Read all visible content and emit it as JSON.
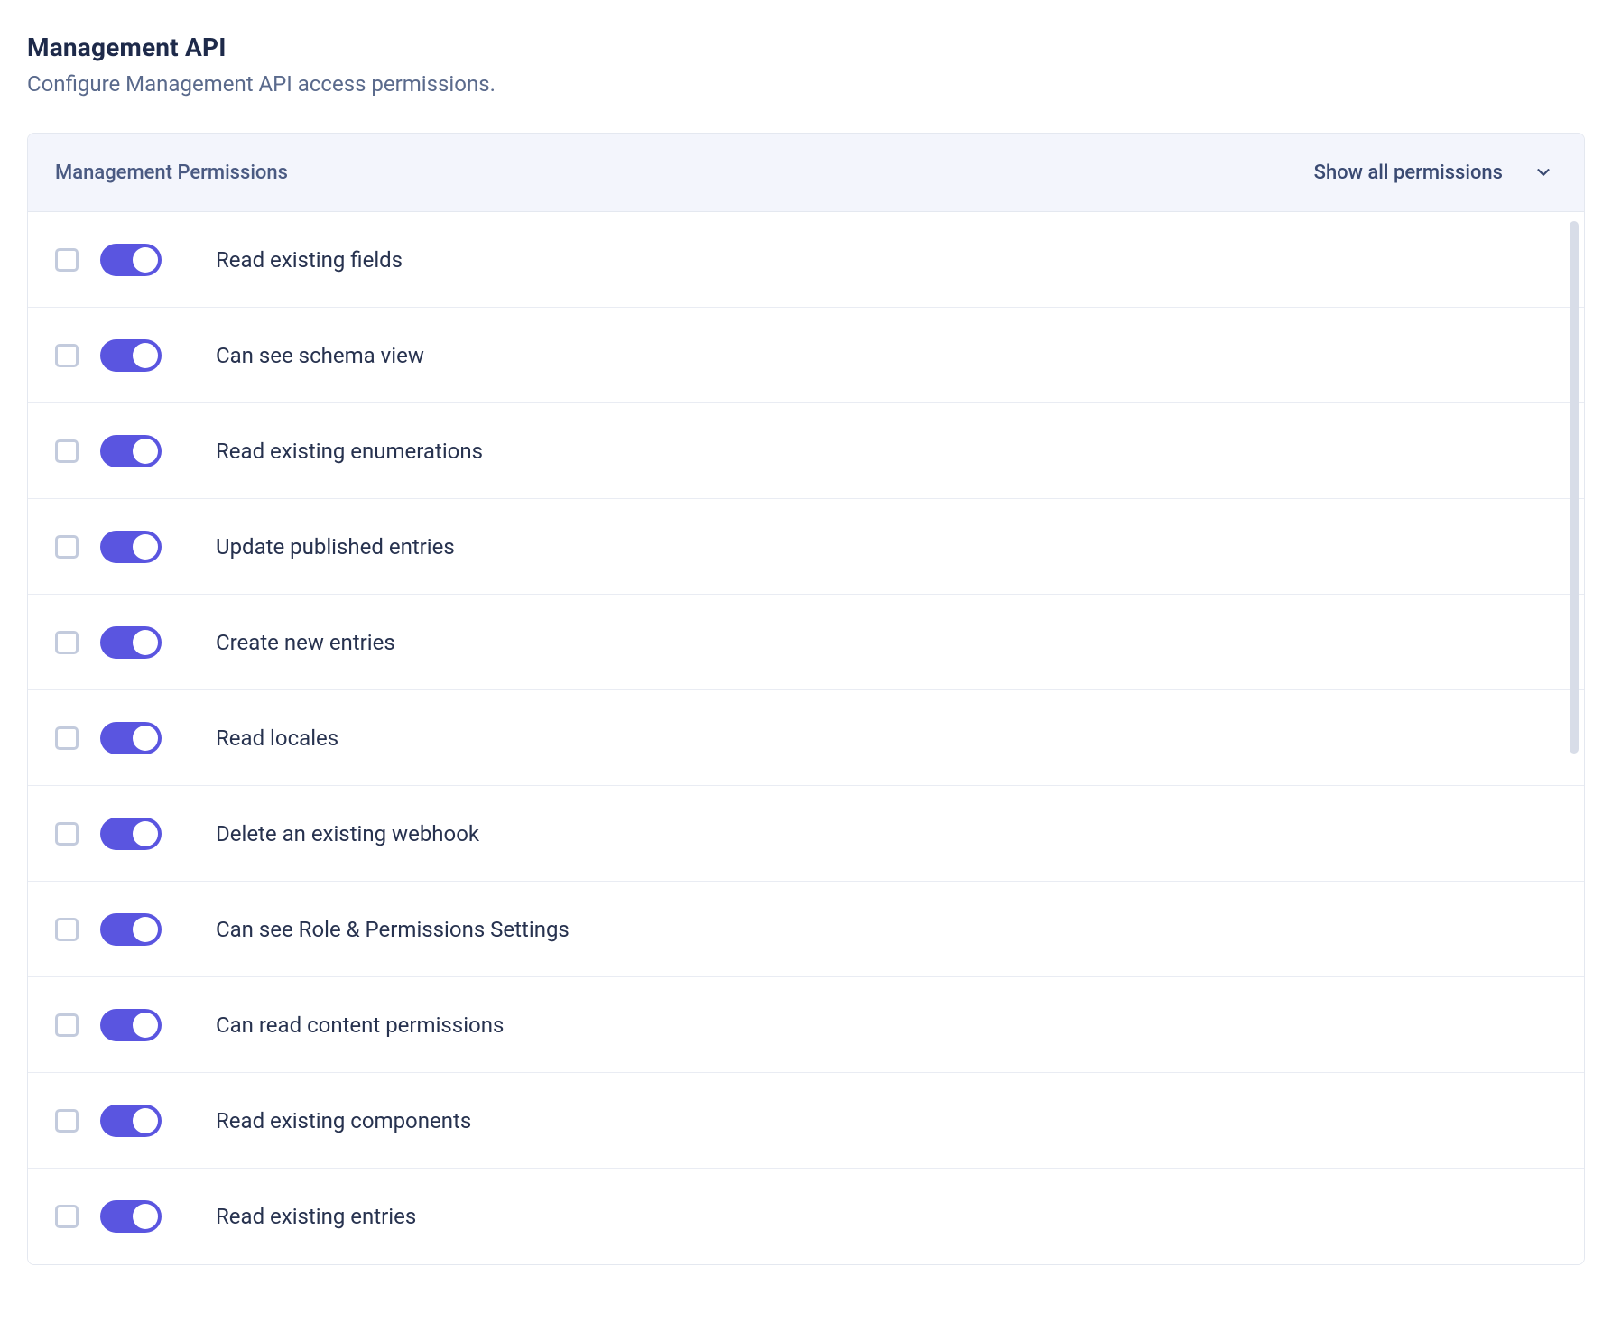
{
  "header": {
    "title": "Management API",
    "subtitle": "Configure Management API access permissions."
  },
  "panel": {
    "title": "Management Permissions",
    "showAllLabel": "Show all permissions"
  },
  "colors": {
    "accent": "#5a55e0"
  },
  "permissions": [
    {
      "label": "Read existing fields",
      "checked": false,
      "enabled": true
    },
    {
      "label": "Can see schema view",
      "checked": false,
      "enabled": true
    },
    {
      "label": "Read existing enumerations",
      "checked": false,
      "enabled": true
    },
    {
      "label": "Update published entries",
      "checked": false,
      "enabled": true
    },
    {
      "label": "Create new entries",
      "checked": false,
      "enabled": true
    },
    {
      "label": "Read locales",
      "checked": false,
      "enabled": true
    },
    {
      "label": "Delete an existing webhook",
      "checked": false,
      "enabled": true
    },
    {
      "label": "Can see Role & Permissions Settings",
      "checked": false,
      "enabled": true
    },
    {
      "label": "Can read content permissions",
      "checked": false,
      "enabled": true
    },
    {
      "label": "Read existing components",
      "checked": false,
      "enabled": true
    },
    {
      "label": "Read existing entries",
      "checked": false,
      "enabled": true
    }
  ]
}
